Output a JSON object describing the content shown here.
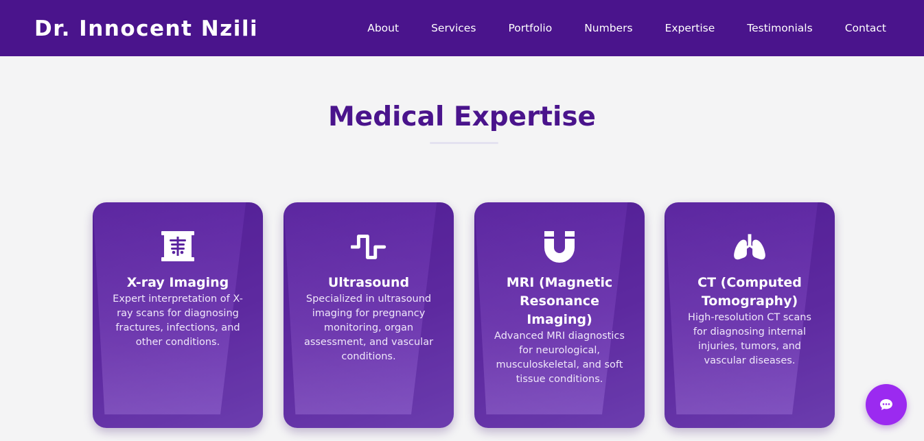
{
  "brand": {
    "name": "Dr. Innocent Nzili"
  },
  "nav": {
    "items": [
      {
        "label": "About"
      },
      {
        "label": "Services"
      },
      {
        "label": "Portfolio"
      },
      {
        "label": "Numbers"
      },
      {
        "label": "Expertise"
      },
      {
        "label": "Testimonials"
      },
      {
        "label": "Contact"
      }
    ]
  },
  "expertise": {
    "title": "Medical Expertise",
    "cards": [
      {
        "icon": "x-ray-icon",
        "title": "X-ray Imaging",
        "description": "Expert interpretation of X-ray scans for diagnosing fractures, infections, and other conditions."
      },
      {
        "icon": "wave-square-icon",
        "title": "Ultrasound",
        "description": "Specialized in ultrasound imaging for pregnancy monitoring, organ assessment, and vascular conditions."
      },
      {
        "icon": "magnet-icon",
        "title": "MRI (Magnetic Resonance Imaging)",
        "description": "Advanced MRI diagnostics for neurological, musculoskeletal, and soft tissue conditions."
      },
      {
        "icon": "lungs-icon",
        "title": "CT (Computed Tomography)",
        "description": "High-resolution CT scans for diagnosing internal injuries, tumors, and vascular diseases."
      }
    ]
  },
  "chat": {
    "icon": "chat-icon"
  },
  "colors": {
    "navbar": "#4a148c",
    "title": "#4a148c",
    "card": "#6a33ad",
    "chat_button": "#9b2af0",
    "background": "#f4f4f5"
  }
}
